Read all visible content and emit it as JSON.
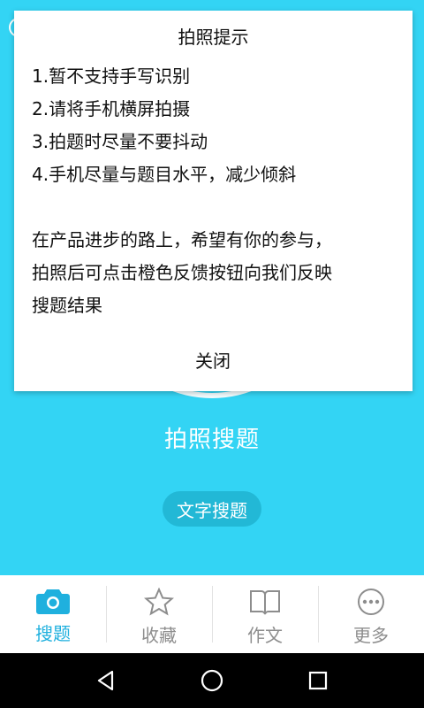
{
  "main": {
    "camera_search_label": "拍照搜题",
    "text_search_label": "文字搜题"
  },
  "dialog": {
    "title": "拍照提示",
    "tips": [
      "1.暂不支持手写识别",
      "2.请将手机横屏拍摄",
      "3.拍题时尽量不要抖动",
      "4.手机尽量与题目水平，减少倾斜"
    ],
    "message_lines": [
      "在产品进步的路上，希望有你的参与，",
      "拍照后可点击橙色反馈按钮向我们反映",
      "搜题结果"
    ],
    "close_label": "关闭"
  },
  "tabs": [
    {
      "label": "搜题",
      "icon": "camera-icon",
      "active": true
    },
    {
      "label": "收藏",
      "icon": "star-icon",
      "active": false
    },
    {
      "label": "作文",
      "icon": "book-icon",
      "active": false
    },
    {
      "label": "更多",
      "icon": "more-icon",
      "active": false
    }
  ],
  "colors": {
    "accent": "#1fb0de",
    "background": "#33d4f4",
    "tab_inactive": "#8d8d8d"
  },
  "navbar": {
    "icons": [
      "back-icon",
      "home-icon",
      "recents-icon"
    ]
  }
}
